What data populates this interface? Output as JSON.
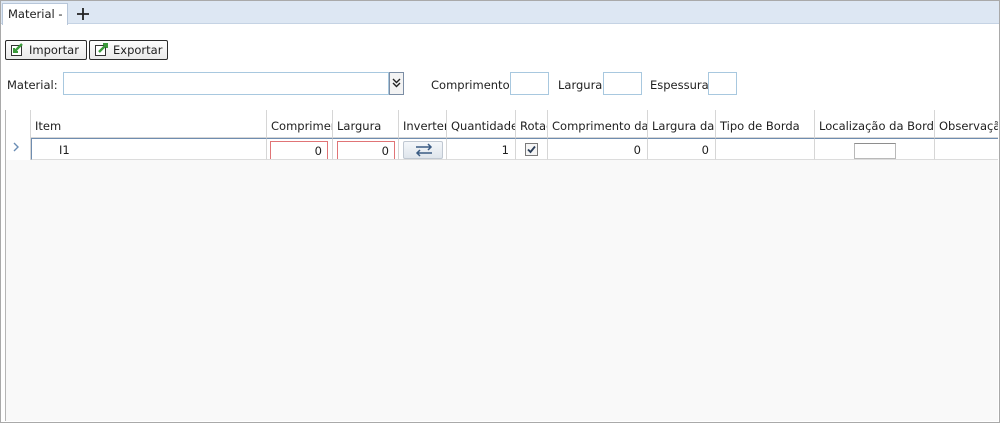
{
  "tabs": {
    "active_label": "Material -",
    "add_icon": "plus-icon"
  },
  "toolbar": {
    "import_label": "Importar",
    "export_label": "Exportar",
    "import_icon": "import-icon",
    "export_icon": "export-icon",
    "icon_color": "#3a9a3a"
  },
  "filters": {
    "material_label": "Material:",
    "material_value": "",
    "dropdown_icon": "double-chevron-down-icon",
    "comprimento_label": "Comprimento:",
    "largura_label": "Largura:",
    "espessura_label": "Espessura:",
    "comprimento_value": "",
    "largura_value": "",
    "espessura_value": ""
  },
  "grid": {
    "columns": [
      "Item",
      "Comprimento",
      "Largura",
      "Inverter",
      "Quantidade",
      "Rotação",
      "Comprimento da",
      "Largura da",
      "Tipo de Borda",
      "Localização da Borda",
      "Observação"
    ],
    "rows": [
      {
        "item": "I1",
        "comprimento": "0",
        "largura": "0",
        "inverter_icon": "swap-arrows-icon",
        "quantidade": "1",
        "rotacao_checked": true,
        "comprimento_da": "0",
        "largura_da": "0",
        "tipo_de_borda": "",
        "localizacao_da_borda": "",
        "observacao": ""
      }
    ],
    "row_indicator_icon": "chevron-right-icon",
    "invalid_border_color": "#e07476"
  }
}
